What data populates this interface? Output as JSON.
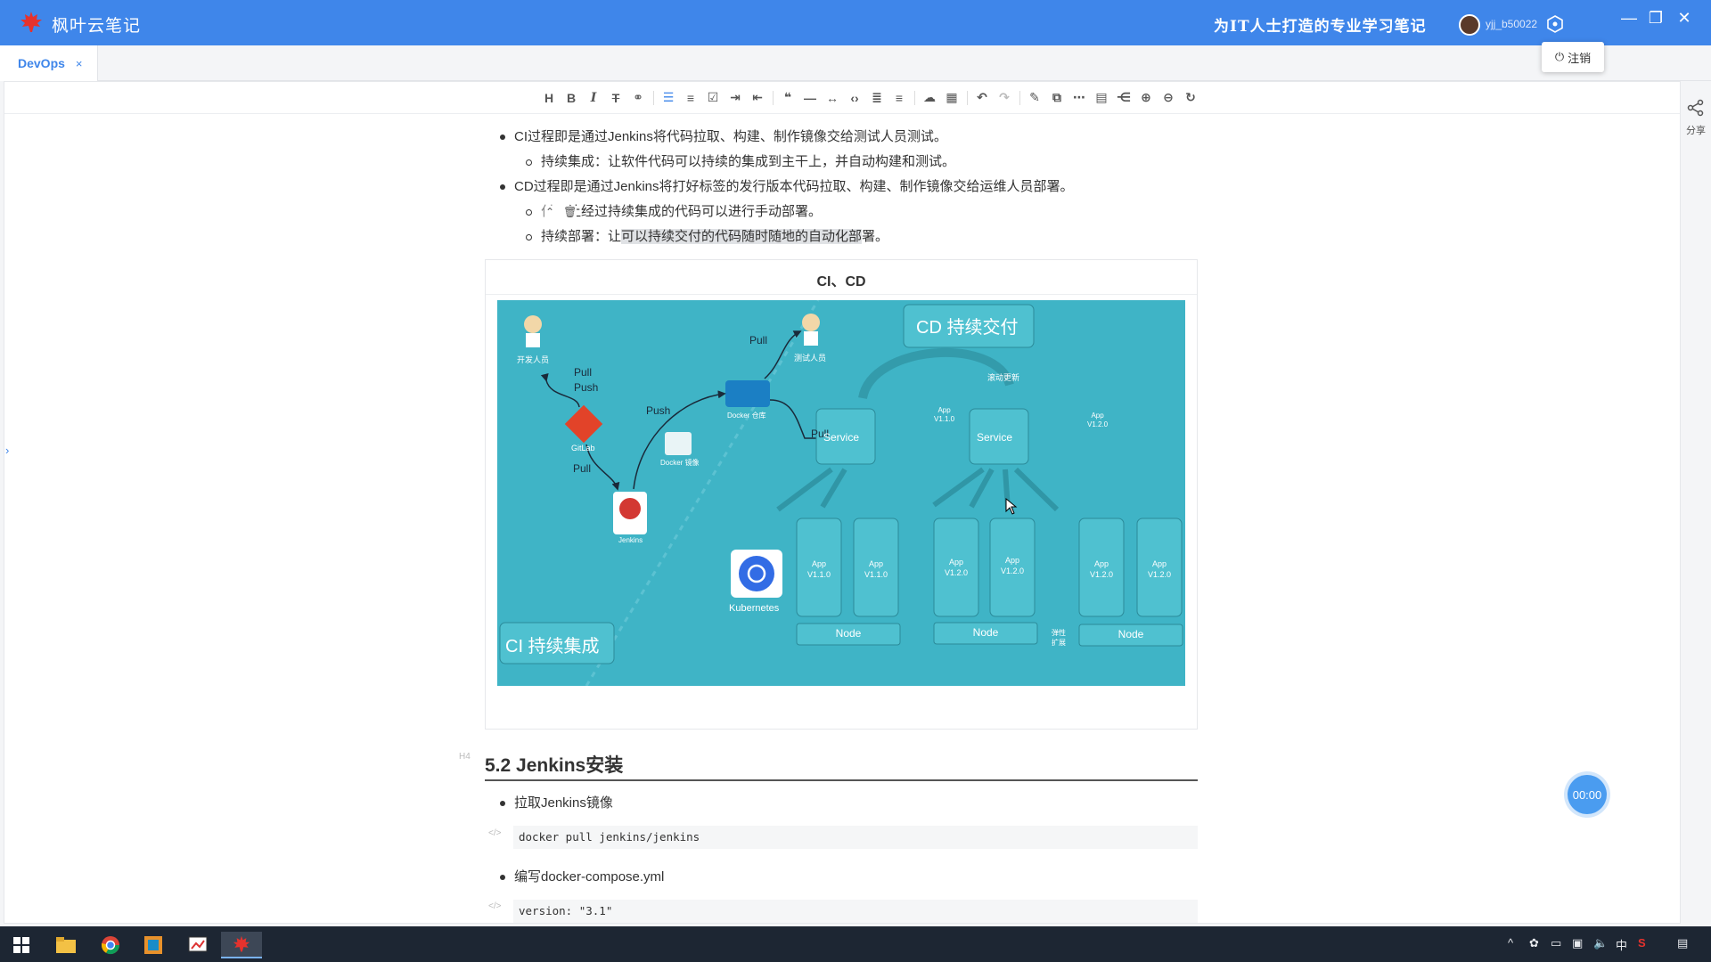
{
  "app": {
    "name": "枫叶云笔记",
    "slogan": "为IT人士打造的专业学习笔记",
    "username": "yjj_b50022",
    "logout_label": "注销",
    "brand_color": "#3f86ea"
  },
  "tabs": [
    {
      "label": "DevOps",
      "close": "×"
    }
  ],
  "toolbar": {
    "icons": [
      "heading-icon",
      "bold-icon",
      "italic-icon",
      "strikethrough-icon",
      "link-icon",
      "unordered-list-icon",
      "ordered-list-icon",
      "checklist-icon",
      "indent-icon",
      "outdent-icon",
      "quote-icon",
      "horizontal-rule-icon",
      "inline-code-icon",
      "code-block-icon",
      "align-icon",
      "align-right-icon",
      "upload-icon",
      "table-icon",
      "undo-icon",
      "redo-icon",
      "edit-icon",
      "preview-icon",
      "more-icon",
      "toc-icon",
      "mindmap-icon",
      "zoom-in-icon",
      "zoom-out-icon",
      "refresh-icon"
    ]
  },
  "content": {
    "b1": "CI过程即是通过Jenkins将代码拉取、构建、制作镜像交给测试人员测试。",
    "b1_1": "持续集成：让软件代码可以持续的集成到主干上，并自动构建和测试。",
    "b2": "CD过程即是通过Jenkins将打好标签的发行版本代码拉取、构建、制作镜像交给运维人员部署。",
    "b2_1": "让经过持续集成的代码可以进行手动部署。",
    "b2_1_prefix": "付：",
    "b2_2_prefix": "持续部署：让",
    "b2_2_highlight": "可以持续交付的代码随时随地的自动化部",
    "b2_2_suffix": "署。",
    "figure_title": "CI、CD",
    "heading_mark": "H4",
    "heading": "5.2 Jenkins安装",
    "b3": "拉取Jenkins镜像",
    "code1": "docker pull jenkins/jenkins",
    "b4": "编写docker-compose.yml",
    "code2": "version: \"3.1\"",
    "code_mark": "</>"
  },
  "diagram": {
    "cd_title": "CD 持续交付",
    "ci_title": "CI 持续集成",
    "dev_label": "开发人员",
    "test_label": "测试人员",
    "gitlab_label": "GitLab",
    "jenkins_label": "Jenkins",
    "docker_repo_label": "Docker 仓库",
    "docker_image_label": "Docker 镜像",
    "k8s_label": "Kubernetes",
    "rolling_label": "滚动更新",
    "scale_label": "弹性扩展",
    "pull": "Pull",
    "push": "Push",
    "service": "Service",
    "node": "Node",
    "app": "App",
    "v110": "V1.1.0",
    "v120": "V1.2.0"
  },
  "timer": "00:00",
  "share_label": "分享",
  "tray": {
    "ime": "中"
  }
}
